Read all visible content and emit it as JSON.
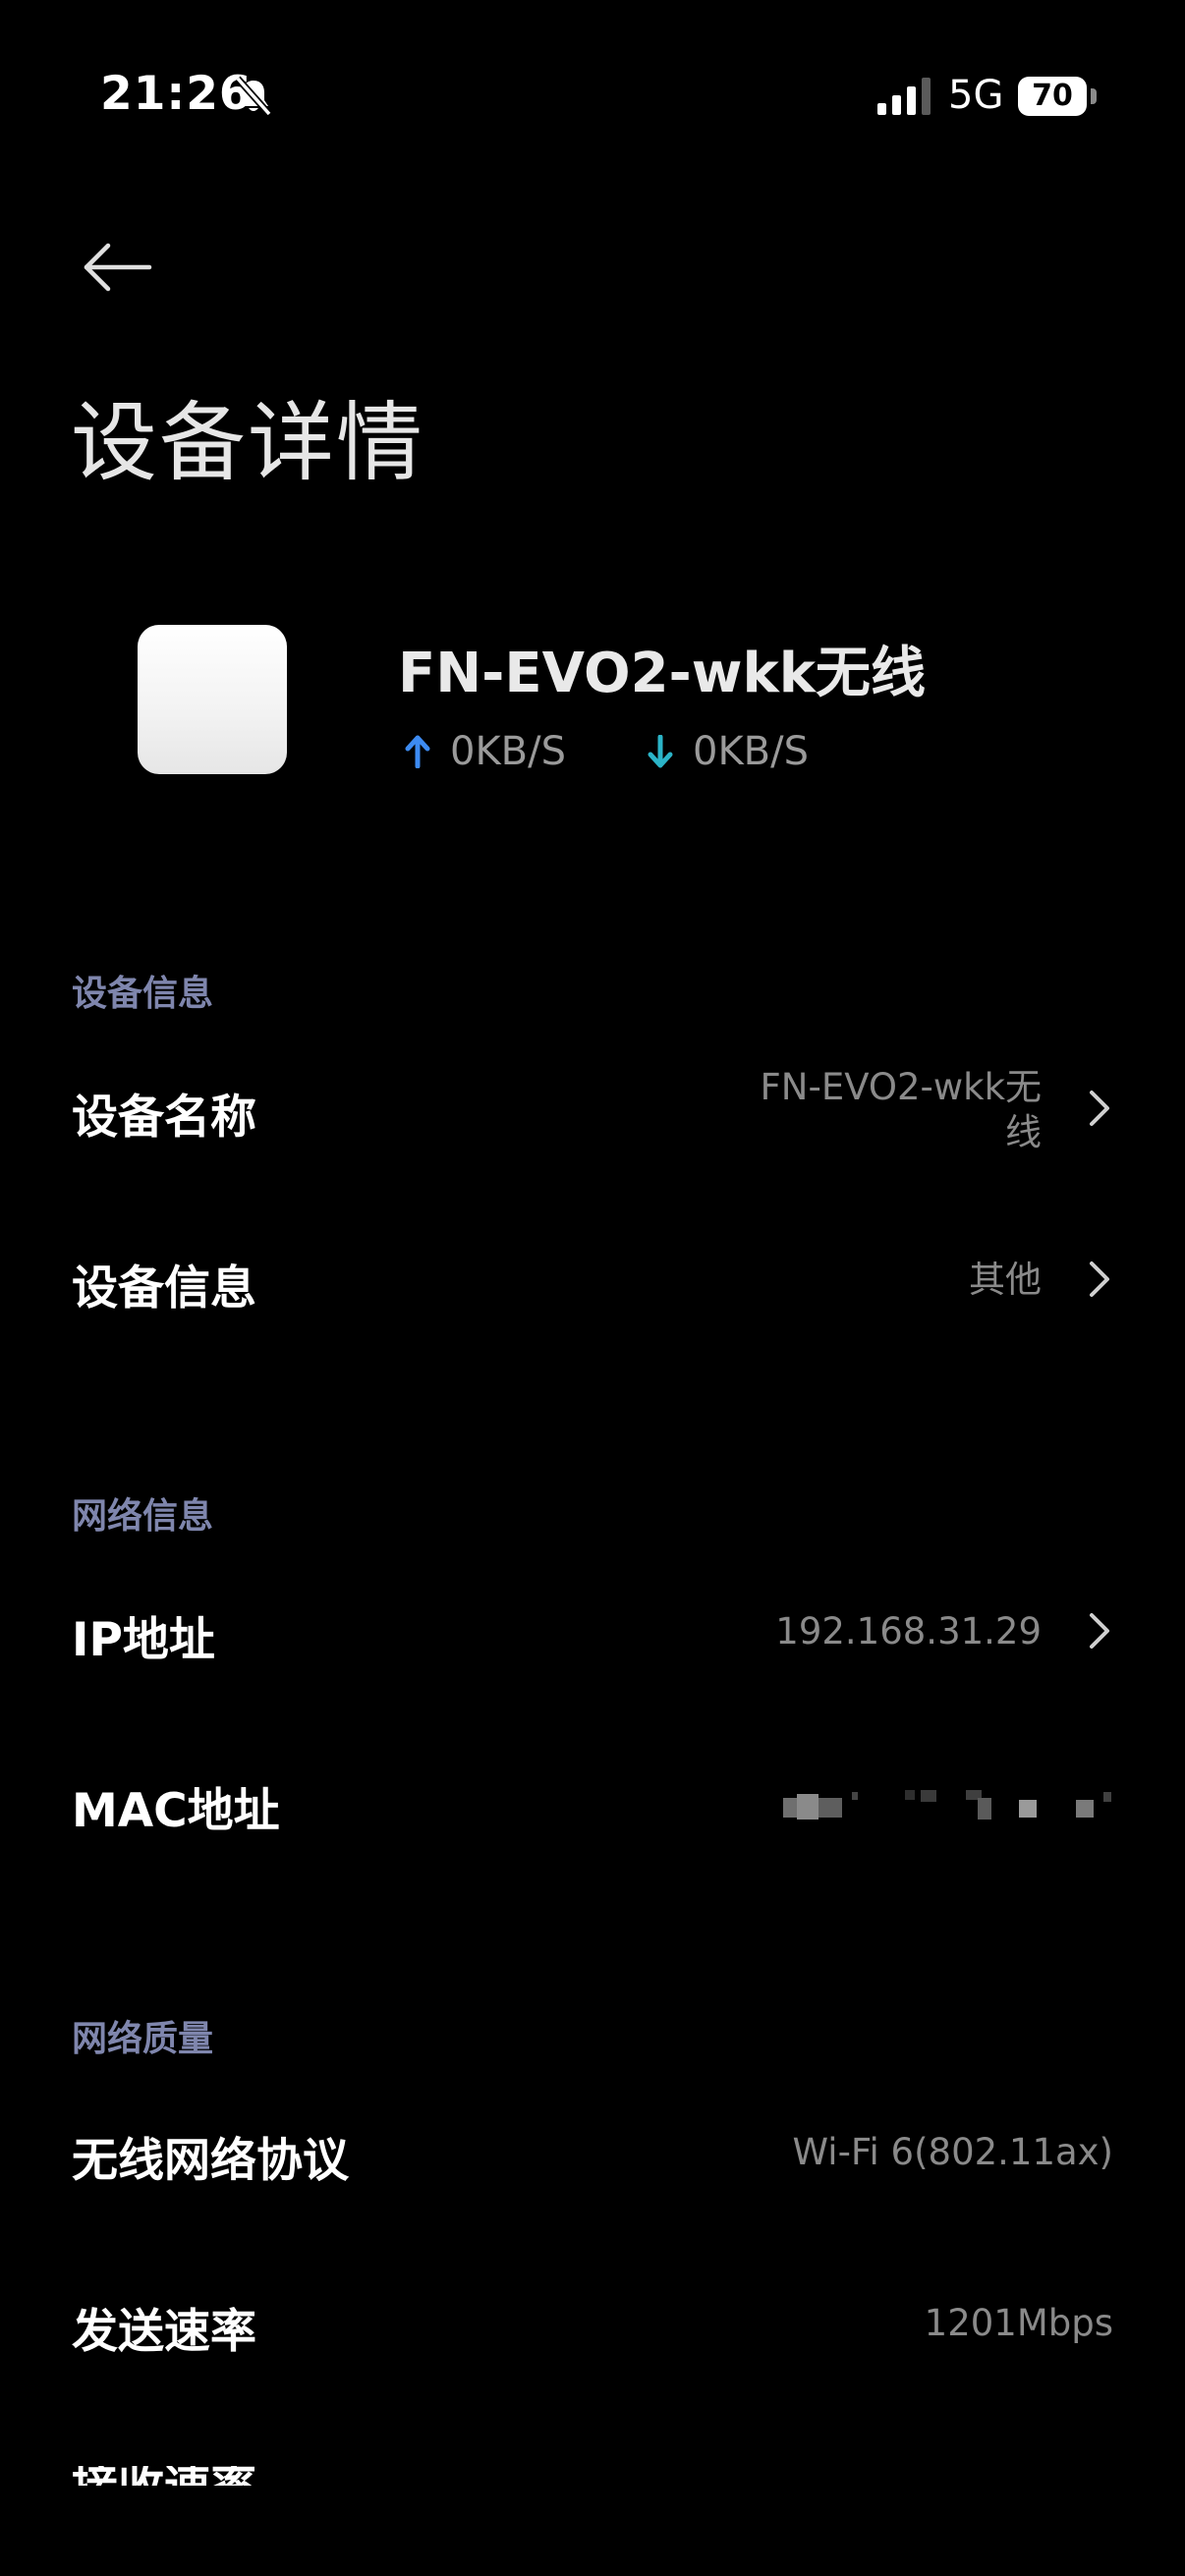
{
  "status_bar": {
    "time": "21:26",
    "network_type": "5G",
    "battery_level": "70",
    "icons": [
      "bell-muted-icon",
      "signal-icon",
      "battery-icon"
    ]
  },
  "header": {
    "back_icon": "arrow-left-icon",
    "title": "设备详情"
  },
  "device": {
    "name": "FN-EVO2-wkk无线",
    "upload_speed": "0KB/S",
    "download_speed": "0KB/S",
    "upload_color": "#3d8bf2",
    "download_color": "#2bb4c8"
  },
  "sections": {
    "device_info": {
      "header": "设备信息",
      "device_name_label": "设备名称",
      "device_name_value_line1": "FN-EVO2-wkk无",
      "device_name_value_line2": "线",
      "device_type_label": "设备信息",
      "device_type_value": "其他"
    },
    "network_info": {
      "header": "网络信息",
      "ip_label": "IP地址",
      "ip_value": "192.168.31.29",
      "mac_label": "MAC地址"
    },
    "network_quality": {
      "header": "网络质量",
      "protocol_label": "无线网络协议",
      "protocol_value": "Wi-Fi 6(802.11ax)",
      "tx_rate_label": "发送速率",
      "tx_rate_value": "1201Mbps",
      "rx_rate_label": "接收速率"
    }
  },
  "colors": {
    "background": "#000000",
    "section_header": "#7f86ad",
    "value_text": "#8a8a8a"
  }
}
